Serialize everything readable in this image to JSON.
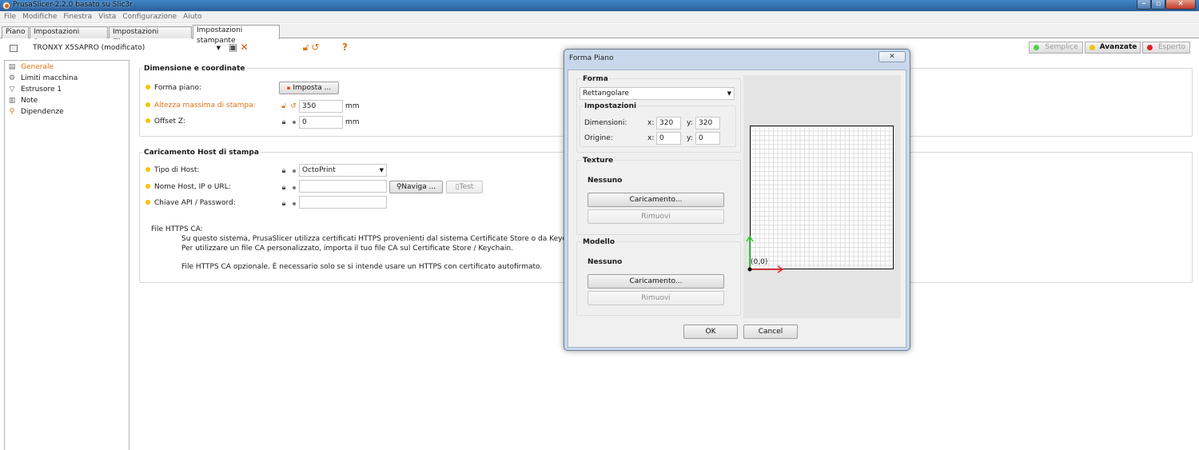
{
  "window": {
    "title": "PrusaSlicer-2.2.0 basato su Slic3r",
    "controls": {
      "minimize": "–",
      "maximize": "▫",
      "close": "✕"
    }
  },
  "menu": [
    "File",
    "Modifiche",
    "Finestra",
    "Vista",
    "Configurazione",
    "Aiuto"
  ],
  "tabs": [
    "Piano",
    "Impostazioni Stampa",
    "Impostazioni Filamento",
    "Impostazioni stampante"
  ],
  "active_tab": "Impostazioni stampante",
  "toolbar": {
    "printer_preset": "TRONXY X5SAPRO (modificato)",
    "help_icon": "?",
    "modes": {
      "simple": "Semplice",
      "advanced": "Avanzate",
      "expert": "Esperto"
    },
    "mode_colors": {
      "simple": "#4fd14a",
      "advanced": "#f5c400",
      "expert": "#e02020"
    }
  },
  "sidebar": {
    "items": [
      "Generale",
      "Limiti macchina",
      "Estrusore 1",
      "Note",
      "Dipendenze"
    ],
    "selected": "Generale"
  },
  "dimensions": {
    "title": "Dimensione e coordinate",
    "bed_shape_label": "Forma piano:",
    "bed_shape_button": "Imposta ...",
    "max_height_label": "Altezza massima di stampa:",
    "max_height_value": "350",
    "offset_z_label": "Offset Z:",
    "offset_z_value": "0",
    "unit": "mm"
  },
  "host": {
    "title": "Caricamento Host di stampa",
    "host_type_label": "Tipo di Host:",
    "host_type_value": "OctoPrint",
    "hostname_label": "Nome Host, IP o URL:",
    "hostname_value": "",
    "browse_button": "Naviga ...",
    "test_button": "Test",
    "apikey_label": "Chiave API / Password:",
    "apikey_value": "",
    "https_ca_label": "File HTTPS CA:",
    "https_lines": [
      "Su questo sistema, PrusaSlicer utilizza certificati HTTPS provenienti dal sistema Certificate Store o da Keychain.",
      "Per utilizzare un file CA personalizzato, importa il tuo file CA sul Certificate Store / Keychain.",
      "File HTTPS CA opzionale. È necessario solo se si intende usare un HTTPS con certificato autofirmato."
    ]
  },
  "dialog": {
    "title": "Forma Piano",
    "close_glyph": "✕",
    "shape_group": "Forma",
    "shape_value": "Rettangolare",
    "settings_group": "Impostazioni",
    "size_label": "Dimensioni:",
    "size_x": "320",
    "size_y": "320",
    "origin_label": "Origine:",
    "origin_x": "0",
    "origin_y": "0",
    "x_label": "x:",
    "y_label": "y:",
    "texture_group": "Texture",
    "texture_value": "Nessuno",
    "model_group": "Modello",
    "model_value": "Nessuno",
    "load_button": "Caricamento...",
    "remove_button": "Rimuovi",
    "origin_marker": "(0,0)",
    "ok_button": "OK",
    "cancel_button": "Cancel"
  }
}
